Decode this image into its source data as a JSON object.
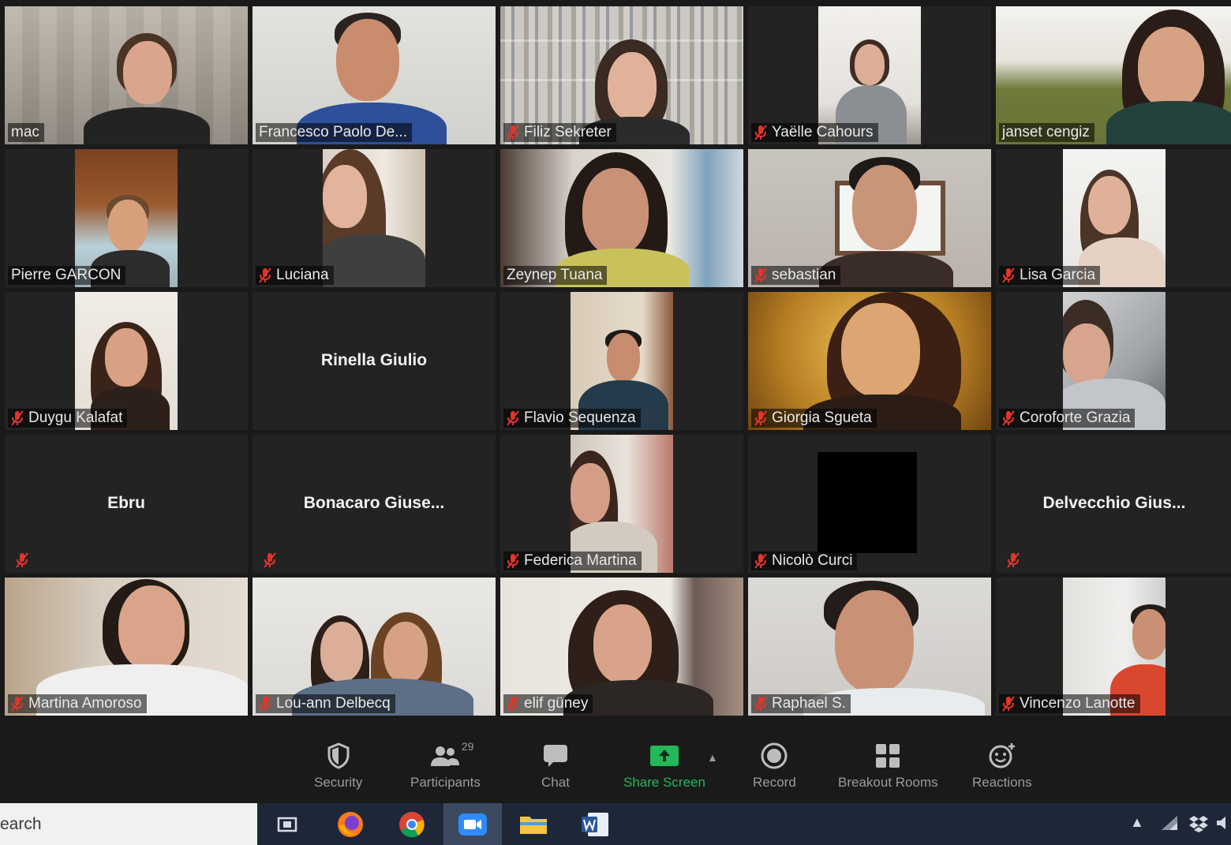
{
  "participants": [
    {
      "name": "mac",
      "muted": false
    },
    {
      "name": "Francesco Paolo De...",
      "muted": false,
      "active_speaker": true
    },
    {
      "name": "Filiz Sekreter",
      "muted": true
    },
    {
      "name": "Yaëlle Cahours",
      "muted": true
    },
    {
      "name": "janset cengiz",
      "muted": false
    },
    {
      "name": "Pierre GARCON",
      "muted": false
    },
    {
      "name": "Luciana",
      "muted": true
    },
    {
      "name": "Zeynep Tuana",
      "muted": false
    },
    {
      "name": "sebastian",
      "muted": true
    },
    {
      "name": "Lisa Garcia",
      "muted": true
    },
    {
      "name": "Duygu Kalafat",
      "muted": true
    },
    {
      "name": "Rinella Giulio",
      "video_off": true
    },
    {
      "name": "Flavio Sequenza",
      "muted": true
    },
    {
      "name": "Giorgia Sgueta",
      "muted": true
    },
    {
      "name": "Coroforte Grazia",
      "muted": true
    },
    {
      "name": "Ebru",
      "video_off": true,
      "muted": true
    },
    {
      "name": "Bonacaro Giuse...",
      "video_off": true,
      "muted": true
    },
    {
      "name": "Federica Martina",
      "muted": true
    },
    {
      "name": "Nicolò Curci",
      "muted": true
    },
    {
      "name": "Delvecchio Gius...",
      "video_off": true,
      "muted": true
    },
    {
      "name": "Martina Amoroso",
      "muted": true
    },
    {
      "name": "Lou-ann Delbecq",
      "muted": true
    },
    {
      "name": "elif güney",
      "muted": true
    },
    {
      "name": "Raphael S.",
      "muted": true
    },
    {
      "name": "Vincenzo Lanotte",
      "muted": true
    }
  ],
  "toolbar": {
    "security": "Security",
    "participants": "Participants",
    "participants_count": "29",
    "chat": "Chat",
    "share_screen": "Share Screen",
    "record": "Record",
    "breakout_rooms": "Breakout Rooms",
    "reactions": "Reactions"
  },
  "taskbar": {
    "search_text": "earch",
    "icons": [
      "task-view-icon",
      "firefox-icon",
      "chrome-icon",
      "zoom-icon",
      "file-explorer-icon",
      "word-icon"
    ]
  },
  "colors": {
    "active_speaker_border": "#cfe355",
    "share_green": "#23b85a",
    "mute_red": "#e0352b",
    "tile_bg": "#232323"
  }
}
